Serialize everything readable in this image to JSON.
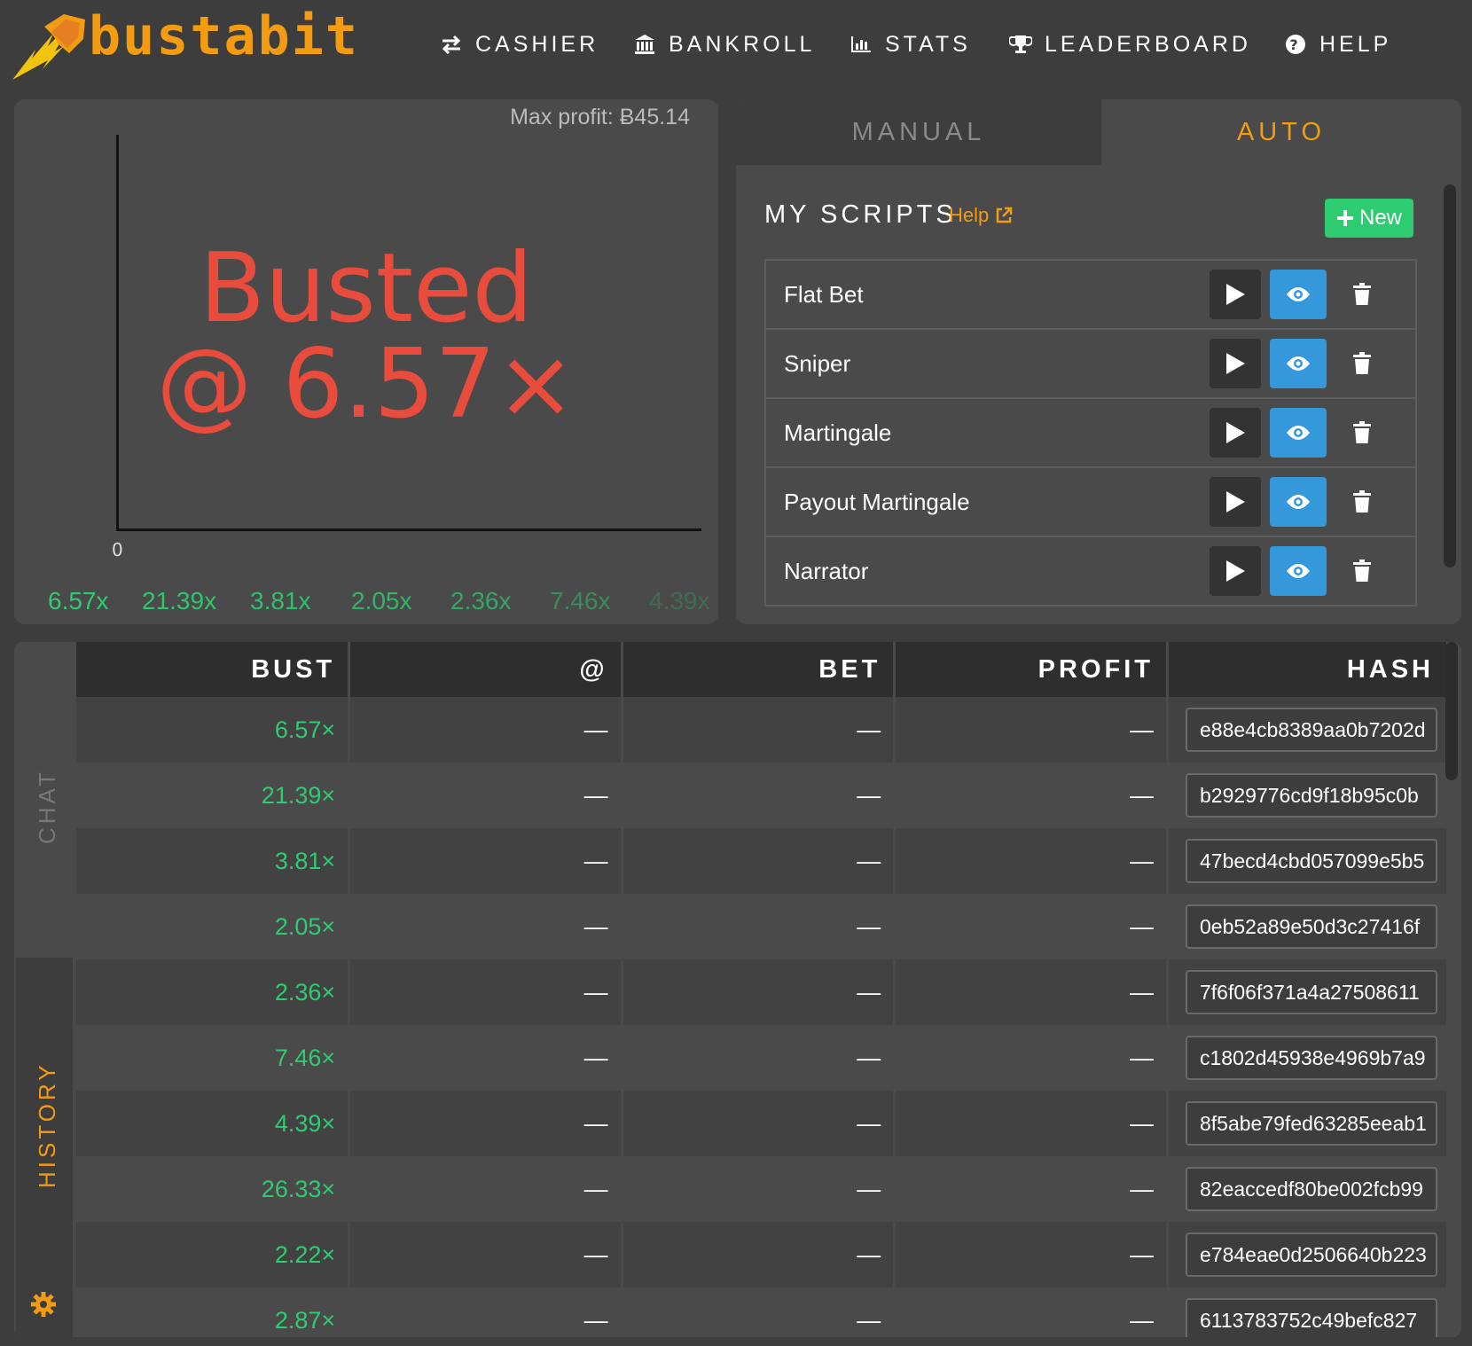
{
  "header": {
    "brand": "bustabit",
    "nav": [
      {
        "label": "CASHIER",
        "icon": "exchange-icon"
      },
      {
        "label": "BANKROLL",
        "icon": "bank-icon"
      },
      {
        "label": "STATS",
        "icon": "bar-chart-icon"
      },
      {
        "label": "LEADERBOARD",
        "icon": "trophy-icon"
      },
      {
        "label": "HELP",
        "icon": "question-circle-icon"
      }
    ]
  },
  "game": {
    "max_profit": "Max profit: Ƀ45.14",
    "axis_zero": "0",
    "busted_line1": "Busted",
    "busted_line2": "@ 6.57×",
    "recent": [
      "6.57x",
      "21.39x",
      "3.81x",
      "2.05x",
      "2.36x",
      "7.46x",
      "4.39x"
    ]
  },
  "scripts_panel": {
    "tabs": {
      "manual": "MANUAL",
      "auto": "AUTO"
    },
    "title": "MY SCRIPTS",
    "help": "Help",
    "new_button": "New",
    "scripts": [
      "Flat Bet",
      "Sniper",
      "Martingale",
      "Payout Martingale",
      "Narrator"
    ]
  },
  "history": {
    "side_tabs": {
      "chat": "CHAT",
      "history": "HISTORY"
    },
    "columns": [
      "BUST",
      "@",
      "BET",
      "PROFIT",
      "HASH"
    ],
    "rows": [
      {
        "bust": "6.57×",
        "at": "—",
        "bet": "—",
        "profit": "—",
        "hash": "e88e4cb8389aa0b7202d"
      },
      {
        "bust": "21.39×",
        "at": "—",
        "bet": "—",
        "profit": "—",
        "hash": "b2929776cd9f18b95c0b"
      },
      {
        "bust": "3.81×",
        "at": "—",
        "bet": "—",
        "profit": "—",
        "hash": "47becd4cbd057099e5b5"
      },
      {
        "bust": "2.05×",
        "at": "—",
        "bet": "—",
        "profit": "—",
        "hash": "0eb52a89e50d3c27416f"
      },
      {
        "bust": "2.36×",
        "at": "—",
        "bet": "—",
        "profit": "—",
        "hash": "7f6f06f371a4a27508611"
      },
      {
        "bust": "7.46×",
        "at": "—",
        "bet": "—",
        "profit": "—",
        "hash": "c1802d45938e4969b7a9"
      },
      {
        "bust": "4.39×",
        "at": "—",
        "bet": "—",
        "profit": "—",
        "hash": "8f5abe79fed63285eeab1"
      },
      {
        "bust": "26.33×",
        "at": "—",
        "bet": "—",
        "profit": "—",
        "hash": "82eaccedf80be002fcb99"
      },
      {
        "bust": "2.22×",
        "at": "—",
        "bet": "—",
        "profit": "—",
        "hash": "e784eae0d2506640b223"
      },
      {
        "bust": "2.87×",
        "at": "—",
        "bet": "—",
        "profit": "—",
        "hash": "6113783752c49befc827"
      }
    ]
  },
  "colors": {
    "accent": "#f39c12",
    "busted": "#e74c3c",
    "green": "#2ecc71",
    "blue": "#3498db",
    "panel": "#4a4a4a",
    "background": "#3d3d3d"
  }
}
